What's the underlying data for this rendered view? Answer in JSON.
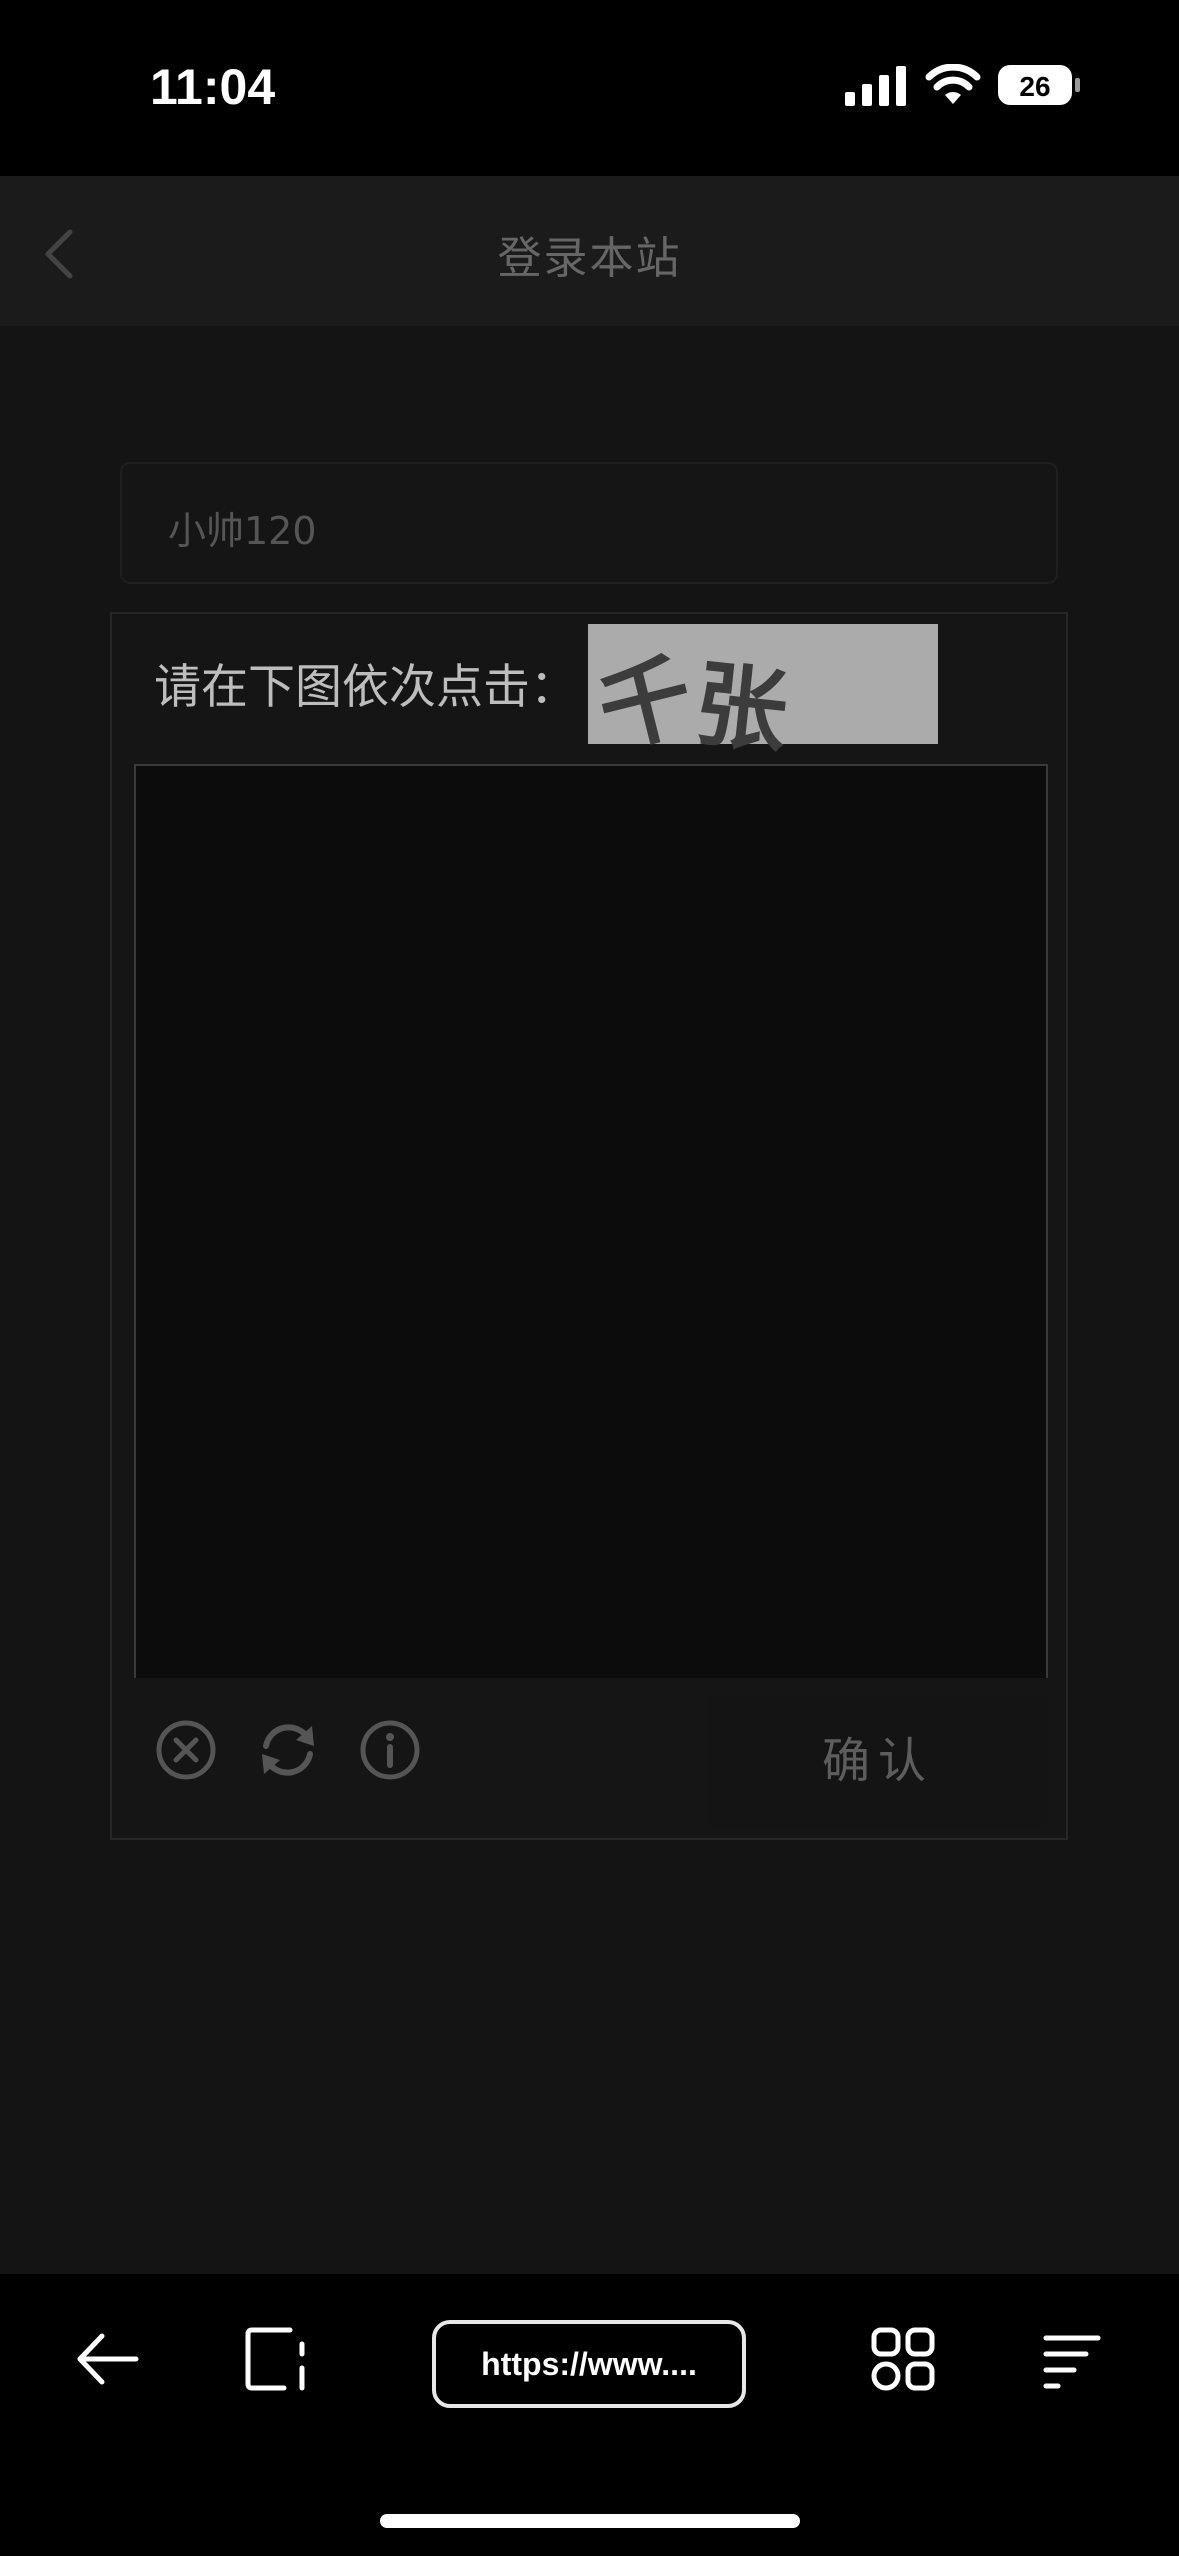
{
  "status_bar": {
    "time": "11:04",
    "battery_level": "26",
    "icons": [
      "signal-icon",
      "wifi-icon",
      "battery-icon"
    ]
  },
  "nav": {
    "title": "登录本站",
    "back_icon": "chevron-left-icon"
  },
  "login_form": {
    "username_value": "小帅120"
  },
  "captcha": {
    "instruction": "请在下图依次点击：",
    "target_chars": [
      "千",
      "张"
    ],
    "footer_icons": [
      "close-circle-icon",
      "refresh-icon",
      "info-icon"
    ],
    "confirm_label": "确认"
  },
  "browser_bar": {
    "url_display": "https://www....",
    "icons": [
      "arrow-left-icon",
      "tabs-icon",
      "grid-icon",
      "menu-icon"
    ]
  },
  "colors": {
    "background": "#141414",
    "status_bar": "#000000",
    "captcha_target_bg": "#ababab"
  }
}
